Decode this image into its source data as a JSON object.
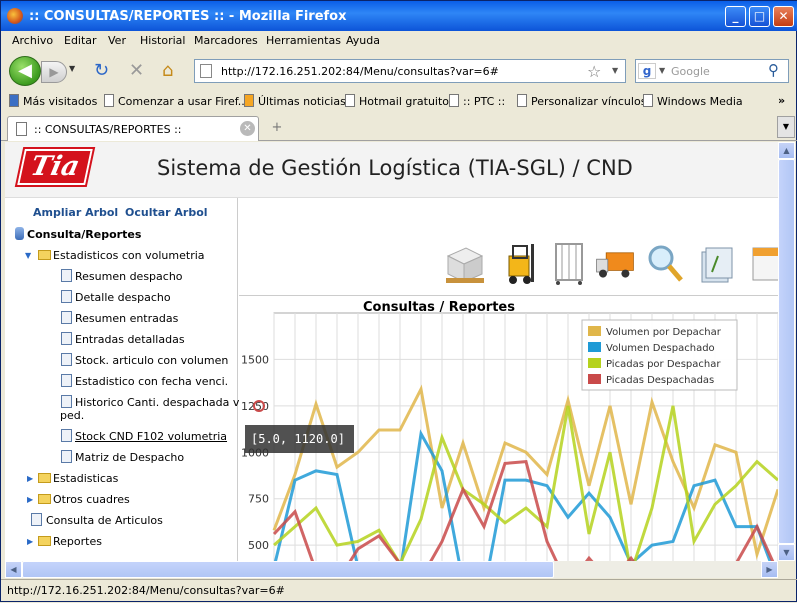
{
  "window": {
    "title": ":: CONSULTAS/REPORTES :: - Mozilla Firefox",
    "min": "_",
    "max": "□",
    "close": "✕"
  },
  "menu": [
    "Archivo",
    "Editar",
    "Ver",
    "Historial",
    "Marcadores",
    "Herramientas",
    "Ayuda"
  ],
  "nav": {
    "back": "◀",
    "forward": "▶",
    "reload": "↻",
    "stop": "✕",
    "home": "⌂",
    "url": "http://172.16.251.202:84/Menu/consultas?var=6#",
    "search_placeholder": "Google",
    "search_engine": "g"
  },
  "bookmarks": [
    "Más visitados",
    "Comenzar a usar Firef...",
    "Últimas noticias",
    "Hotmail gratuito",
    ":: PTC ::",
    "Personalizar vínculos",
    "Windows Media"
  ],
  "bookmarks_more": "»",
  "tab": {
    "title": ":: CONSULTAS/REPORTES ::",
    "new_tab": "+"
  },
  "app": {
    "logo": "Tia",
    "title": "Sistema de Gestión Logística (TIA-SGL) / CND"
  },
  "sidebar": {
    "expand": "Ampliar Arbol",
    "hide": "Ocultar Arbol",
    "root": "Consulta/Reportes",
    "group1": "Estadisticos con volumetria",
    "items": [
      "Resumen despacho",
      "Detalle despacho",
      "Resumen entradas",
      "Entradas detalladas",
      "Stock. articulo con volumen",
      "Estadistico con fecha venci.",
      "Historico Canti. despachada vs.",
      "ped.",
      "Stock CND F102 volumetria",
      "Matriz de Despacho"
    ],
    "groups": [
      "Estadisticas",
      "Otros cuadres"
    ],
    "consulta": "Consulta de Articulos",
    "reportes": "Reportes"
  },
  "icons": [
    "pallet-icon",
    "forklift-icon",
    "cart-rack-icon",
    "truck-icon",
    "magnifier-icon",
    "stacked-documents-icon",
    "calendar-icon"
  ],
  "status": "http://172.16.251.202:84/Menu/consultas?var=6#",
  "colors": {
    "title_bar": "#0a5ee8",
    "accent": "#1f4f8f",
    "logo_red": "#d4121c"
  },
  "chart_data": {
    "type": "line",
    "title": "Consultas / Reportes",
    "ylim": [
      350,
      1750
    ],
    "yticks": [
      "500",
      "750",
      "1000",
      "1250",
      "1500"
    ],
    "tooltip": "[5.0, 1120.0]",
    "legend_position": "top-right",
    "grid": true,
    "x": [
      0,
      1,
      2,
      3,
      4,
      5,
      6,
      7,
      8,
      9,
      10,
      11,
      12,
      13,
      14,
      15,
      16,
      17,
      18,
      19,
      20,
      21,
      22,
      23,
      24
    ],
    "series": [
      {
        "name": "Volumen por Depachar",
        "color": "#e0b64a",
        "values": [
          580,
          880,
          1260,
          920,
          1000,
          1120,
          1120,
          1340,
          700,
          1050,
          700,
          1050,
          1000,
          880,
          1280,
          820,
          1250,
          720,
          1270,
          950,
          700,
          1040,
          1000,
          450,
          800
        ]
      },
      {
        "name": "Volumen Despachado",
        "color": "#1e9ad6",
        "values": [
          380,
          850,
          900,
          880,
          380,
          300,
          350,
          1100,
          900,
          300,
          250,
          850,
          850,
          820,
          650,
          780,
          650,
          400,
          500,
          520,
          820,
          850,
          600,
          600,
          300
        ]
      },
      {
        "name": "Picadas por Despachar",
        "color": "#b5d21d",
        "values": [
          500,
          600,
          700,
          500,
          520,
          580,
          400,
          640,
          1080,
          800,
          720,
          620,
          700,
          600,
          1250,
          560,
          1000,
          350,
          700,
          1250,
          520,
          720,
          820,
          950,
          850
        ]
      },
      {
        "name": "Picadas Despachadas",
        "color": "#c94a4a",
        "values": [
          560,
          680,
          360,
          300,
          480,
          550,
          400,
          320,
          520,
          800,
          600,
          940,
          950,
          520,
          280,
          430,
          300,
          430,
          270,
          380,
          220,
          300,
          400,
          600,
          350
        ]
      }
    ]
  }
}
